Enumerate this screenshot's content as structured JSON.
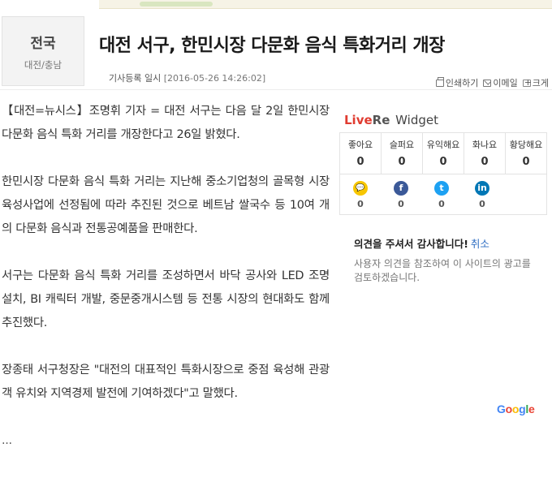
{
  "section": {
    "title": "전국",
    "subtitle": "대전/충남"
  },
  "article": {
    "headline": "대전 서구, 한민시장 다문화 음식 특화거리 개장",
    "meta_label": "기사등록 일시",
    "meta_date": "[2016-05-26 14:26:02]",
    "paragraphs": [
      "【대전=뉴시스】조명휘 기자 = 대전 서구는 다음 달 2일 한민시장 다문화 음식 특화 거리를 개장한다고 26일 밝혔다.",
      "한민시장 다문화 음식 특화 거리는 지난해 중소기업청의 골목형 시장 육성사업에 선정됨에 따라 추진된 것으로 베트남 쌀국수 등 10여 개의 다문화 음식과 전통공예품을 판매한다.",
      "서구는 다문화 음식 특화 거리를 조성하면서 바닥 공사와 LED 조명 설치, BI 캐릭터 개발, 중문중개시스템 등 전통 시장의 현대화도 함께 추진했다.",
      "장종태 서구청장은 \"대전의 대표적인 특화시장으로 중점 육성해 관광객 유치와 지역경제 발전에 기여하겠다\"고 말했다."
    ],
    "trailing_text": "..."
  },
  "tools": {
    "print": "인쇄하기",
    "email": "이메일",
    "more": "크게"
  },
  "livere": {
    "brand_live": "Live",
    "brand_re": "Re",
    "brand_widget": "Widget",
    "reactions": [
      {
        "label": "좋아요",
        "count": "0"
      },
      {
        "label": "슬퍼요",
        "count": "0"
      },
      {
        "label": "유익해요",
        "count": "0"
      },
      {
        "label": "화나요",
        "count": "0"
      },
      {
        "label": "황당해요",
        "count": "0"
      }
    ],
    "shares": [
      {
        "icon": "kakao-icon",
        "glyph": "💬",
        "color": "#f7c600",
        "count": "0"
      },
      {
        "icon": "facebook-icon",
        "glyph": "f",
        "color": "#3b5998",
        "count": "0"
      },
      {
        "icon": "twitter-icon",
        "glyph": "t",
        "color": "#1da1f2",
        "count": "0"
      },
      {
        "icon": "linkedin-icon",
        "glyph": "in",
        "color": "#0077b5",
        "count": "0"
      }
    ],
    "thanks": "의견을 주셔서 감사합니다!",
    "cancel": "취소",
    "note": "사용자 의견을 참조하여 이 사이트의 광고를 검토하겠습니다."
  },
  "google_logo": [
    "G",
    "o",
    "o",
    "g",
    "l",
    "e"
  ]
}
